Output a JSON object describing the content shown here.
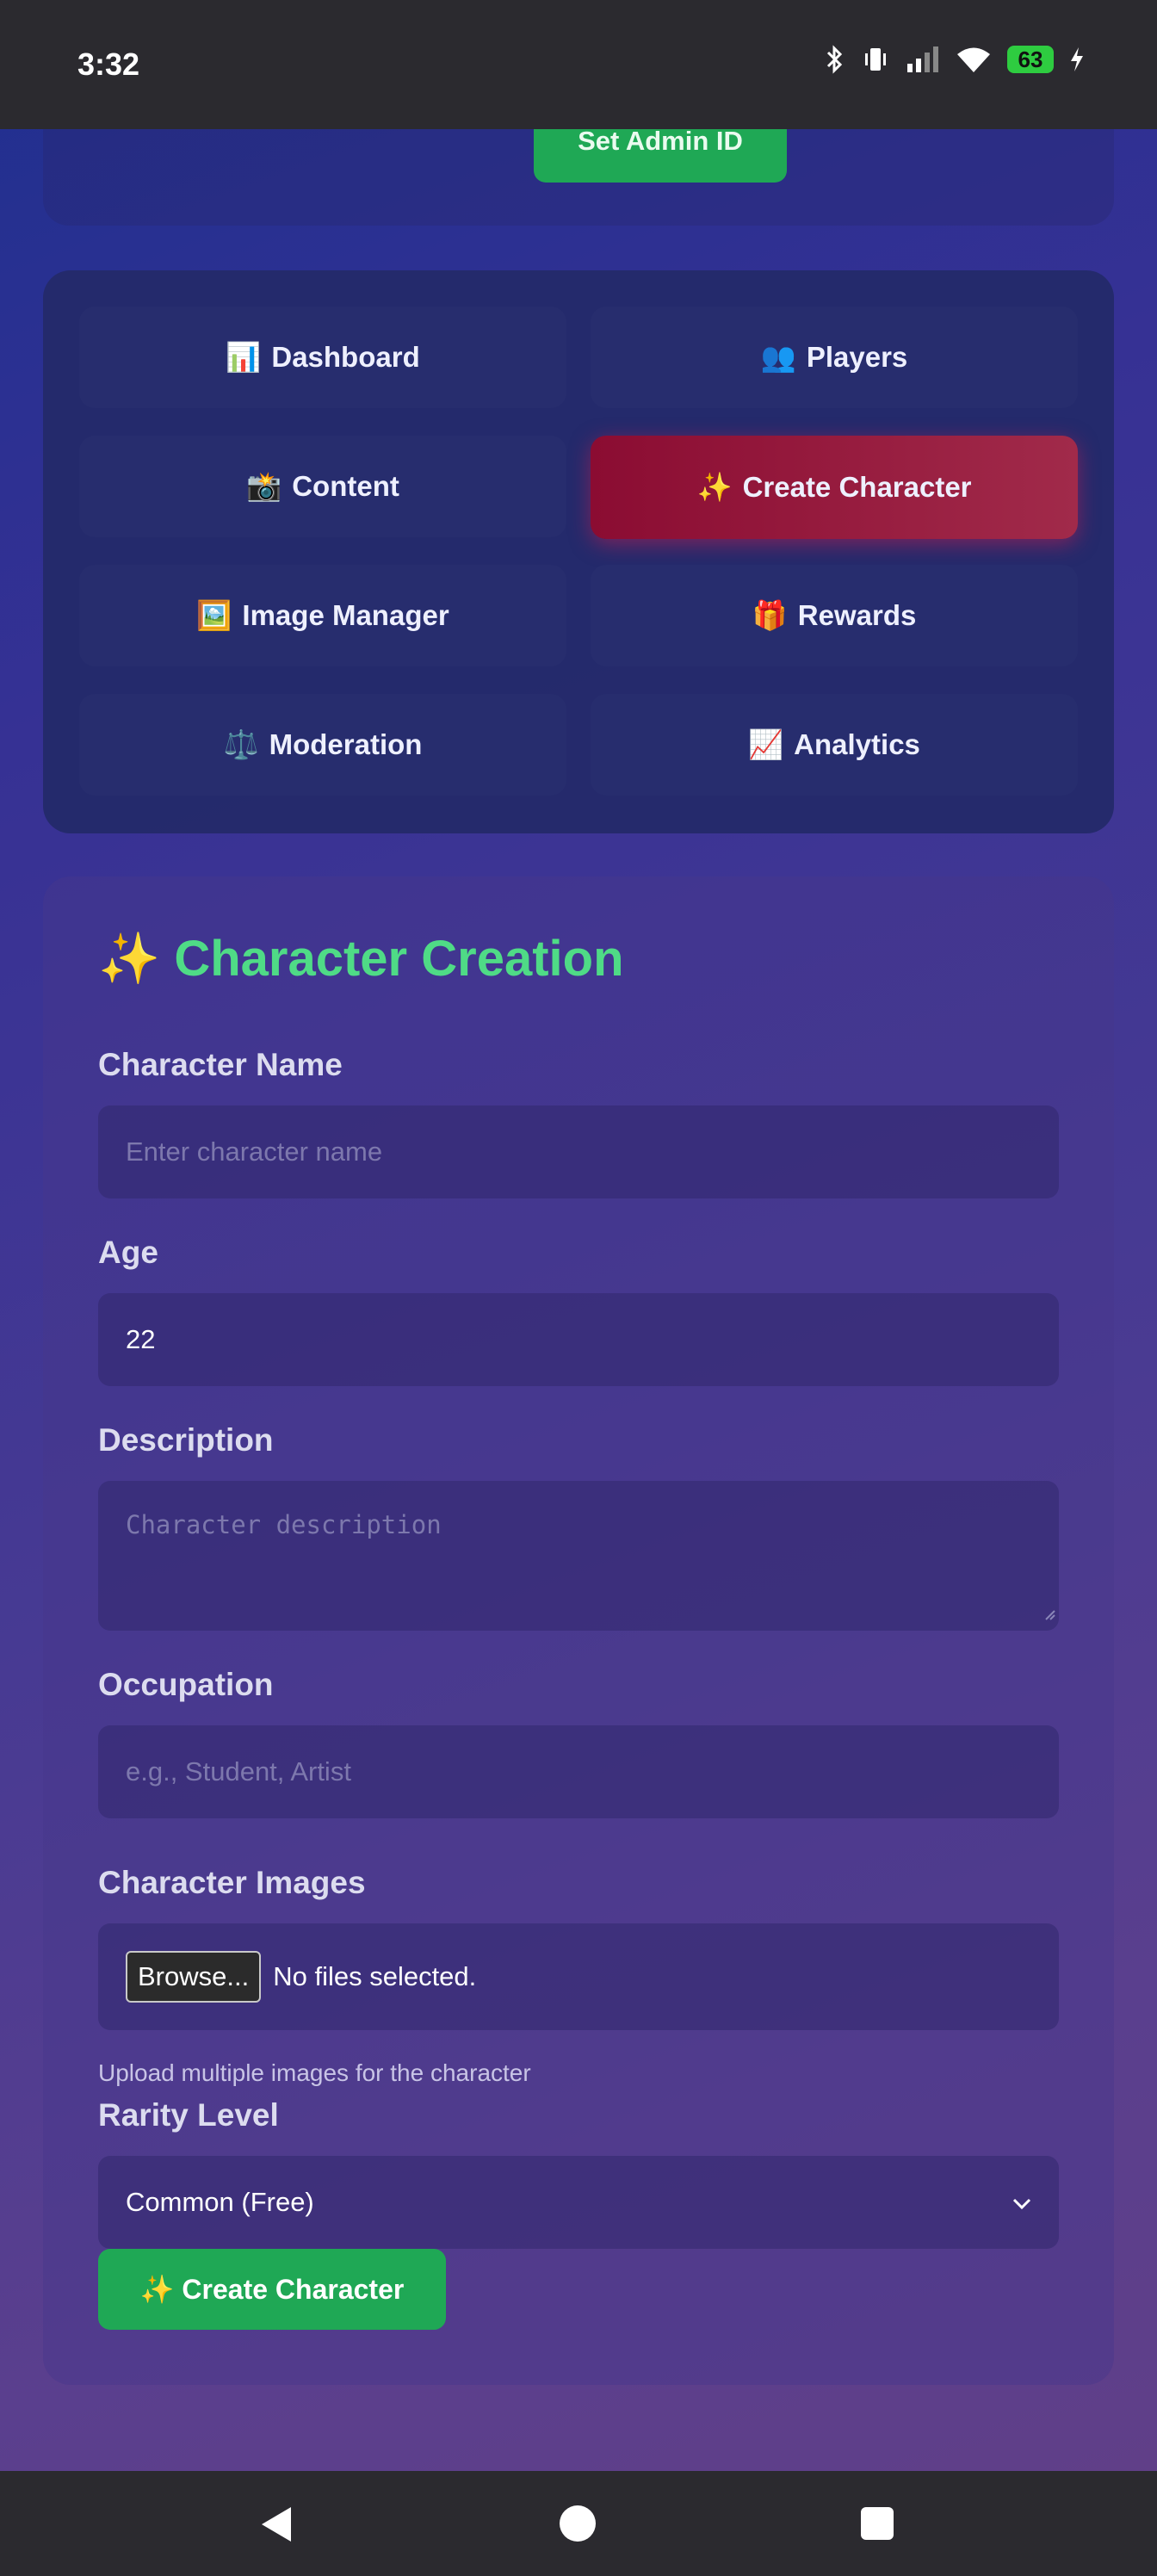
{
  "status_bar": {
    "time": "3:32",
    "battery": "63",
    "icons": [
      "bluetooth-icon",
      "vibrate-icon",
      "signal-icon",
      "wifi-icon",
      "battery-icon",
      "charging-icon"
    ]
  },
  "top": {
    "set_admin_label": "Set Admin ID"
  },
  "nav": {
    "items": [
      {
        "emoji": "📊",
        "label": "Dashboard"
      },
      {
        "emoji": "👥",
        "label": "Players"
      },
      {
        "emoji": "📸",
        "label": "Content"
      },
      {
        "emoji": "✨",
        "label": "Create Character"
      },
      {
        "emoji": "🖼️",
        "label": "Image Manager"
      },
      {
        "emoji": "🎁",
        "label": "Rewards"
      },
      {
        "emoji": "⚖️",
        "label": "Moderation"
      },
      {
        "emoji": "📈",
        "label": "Analytics"
      }
    ],
    "active": "Create Character"
  },
  "form": {
    "title": "✨ Character Creation",
    "name": {
      "label": "Character Name",
      "placeholder": "Enter character name",
      "value": ""
    },
    "age": {
      "label": "Age",
      "value": "22"
    },
    "description": {
      "label": "Description",
      "placeholder": "Character description",
      "value": ""
    },
    "occupation": {
      "label": "Occupation",
      "placeholder": "e.g., Student, Artist",
      "value": ""
    },
    "images": {
      "label": "Character Images",
      "browse_label": "Browse...",
      "status": "No files selected.",
      "help": "Upload multiple images for the character"
    },
    "rarity": {
      "label": "Rarity Level",
      "selected": "Common (Free)"
    },
    "submit_label": "✨ Create Character"
  },
  "colors": {
    "accent_green": "#1fa855",
    "title_green": "#4fdb86",
    "active_tab": "#8b0c32"
  }
}
